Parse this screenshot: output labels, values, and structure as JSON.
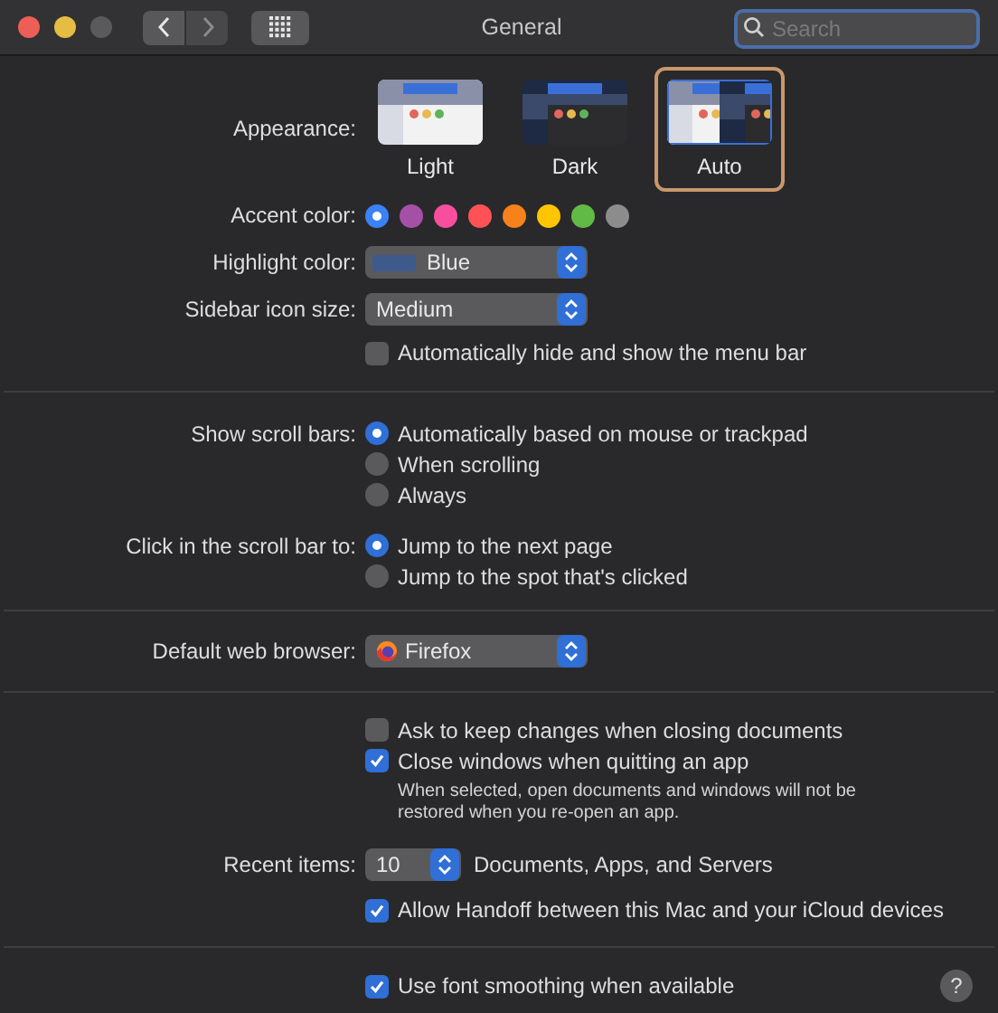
{
  "window": {
    "title": "General"
  },
  "search": {
    "placeholder": "Search"
  },
  "appearance": {
    "label": "Appearance:",
    "options": [
      {
        "label": "Light",
        "kind": "light",
        "selected": false
      },
      {
        "label": "Dark",
        "kind": "dark",
        "selected": false
      },
      {
        "label": "Auto",
        "kind": "auto",
        "selected": true
      }
    ]
  },
  "accent": {
    "label": "Accent color:",
    "colors": [
      {
        "color": "#3b82f6",
        "selected": true
      },
      {
        "color": "#a550a7",
        "selected": false
      },
      {
        "color": "#f74f9e",
        "selected": false
      },
      {
        "color": "#ff5257",
        "selected": false
      },
      {
        "color": "#f7821b",
        "selected": false
      },
      {
        "color": "#ffc600",
        "selected": false
      },
      {
        "color": "#62ba46",
        "selected": false
      },
      {
        "color": "#8c8c8c",
        "selected": false
      }
    ]
  },
  "highlight_color": {
    "label": "Highlight color:",
    "value": "Blue"
  },
  "sidebar_icon_size": {
    "label": "Sidebar icon size:",
    "value": "Medium"
  },
  "menu_bar_checkbox": {
    "label": "Automatically hide and show the menu bar",
    "checked": false
  },
  "show_scroll_bars": {
    "label": "Show scroll bars:",
    "options": [
      {
        "label": "Automatically based on mouse or trackpad",
        "selected": true
      },
      {
        "label": "When scrolling",
        "selected": false
      },
      {
        "label": "Always",
        "selected": false
      }
    ]
  },
  "click_scroll_bar": {
    "label": "Click in the scroll bar to:",
    "options": [
      {
        "label": "Jump to the next page",
        "selected": true
      },
      {
        "label": "Jump to the spot that's clicked",
        "selected": false
      }
    ]
  },
  "default_browser": {
    "label": "Default web browser:",
    "value": "Firefox"
  },
  "document_checkboxes": [
    {
      "label": "Ask to keep changes when closing documents",
      "checked": false
    },
    {
      "label": "Close windows when quitting an app",
      "checked": true
    }
  ],
  "note": "When selected, open documents and windows will not be restored when you re-open an app.",
  "recent_items": {
    "label": "Recent items:",
    "value": "10",
    "suffix": "Documents, Apps, and Servers"
  },
  "handoff": {
    "label": "Allow Handoff between this Mac and your iCloud devices",
    "checked": true
  },
  "font_smoothing": {
    "label": "Use font smoothing when available",
    "checked": true
  },
  "help": "?"
}
